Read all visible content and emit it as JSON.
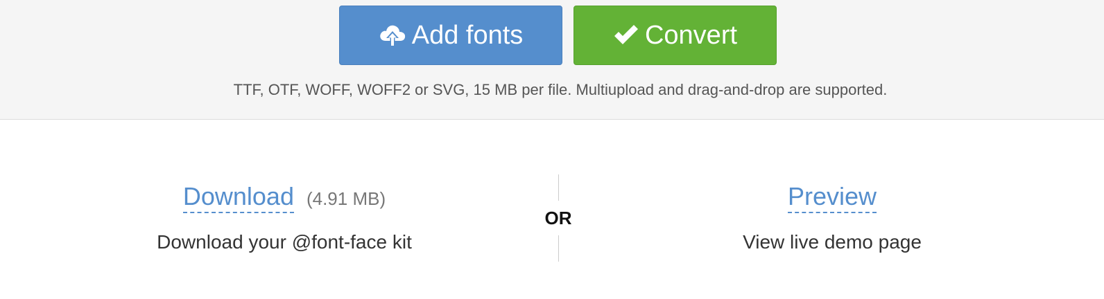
{
  "toolbar": {
    "add_fonts_label": "Add fonts",
    "add_fonts_icon": "cloud-upload-icon",
    "convert_label": "Convert",
    "convert_icon": "checkmark-icon",
    "add_color": "#558ecd",
    "convert_color": "#63b236"
  },
  "hint_text": "TTF, OTF, WOFF, WOFF2 or SVG, 15 MB per file. Multiupload and drag-and-drop are supported.",
  "download": {
    "link_label": "Download",
    "size": "(4.91 MB)",
    "description": "Download your @font-face kit"
  },
  "separator": {
    "label": "OR"
  },
  "preview": {
    "link_label": "Preview",
    "description": "View live demo page"
  }
}
